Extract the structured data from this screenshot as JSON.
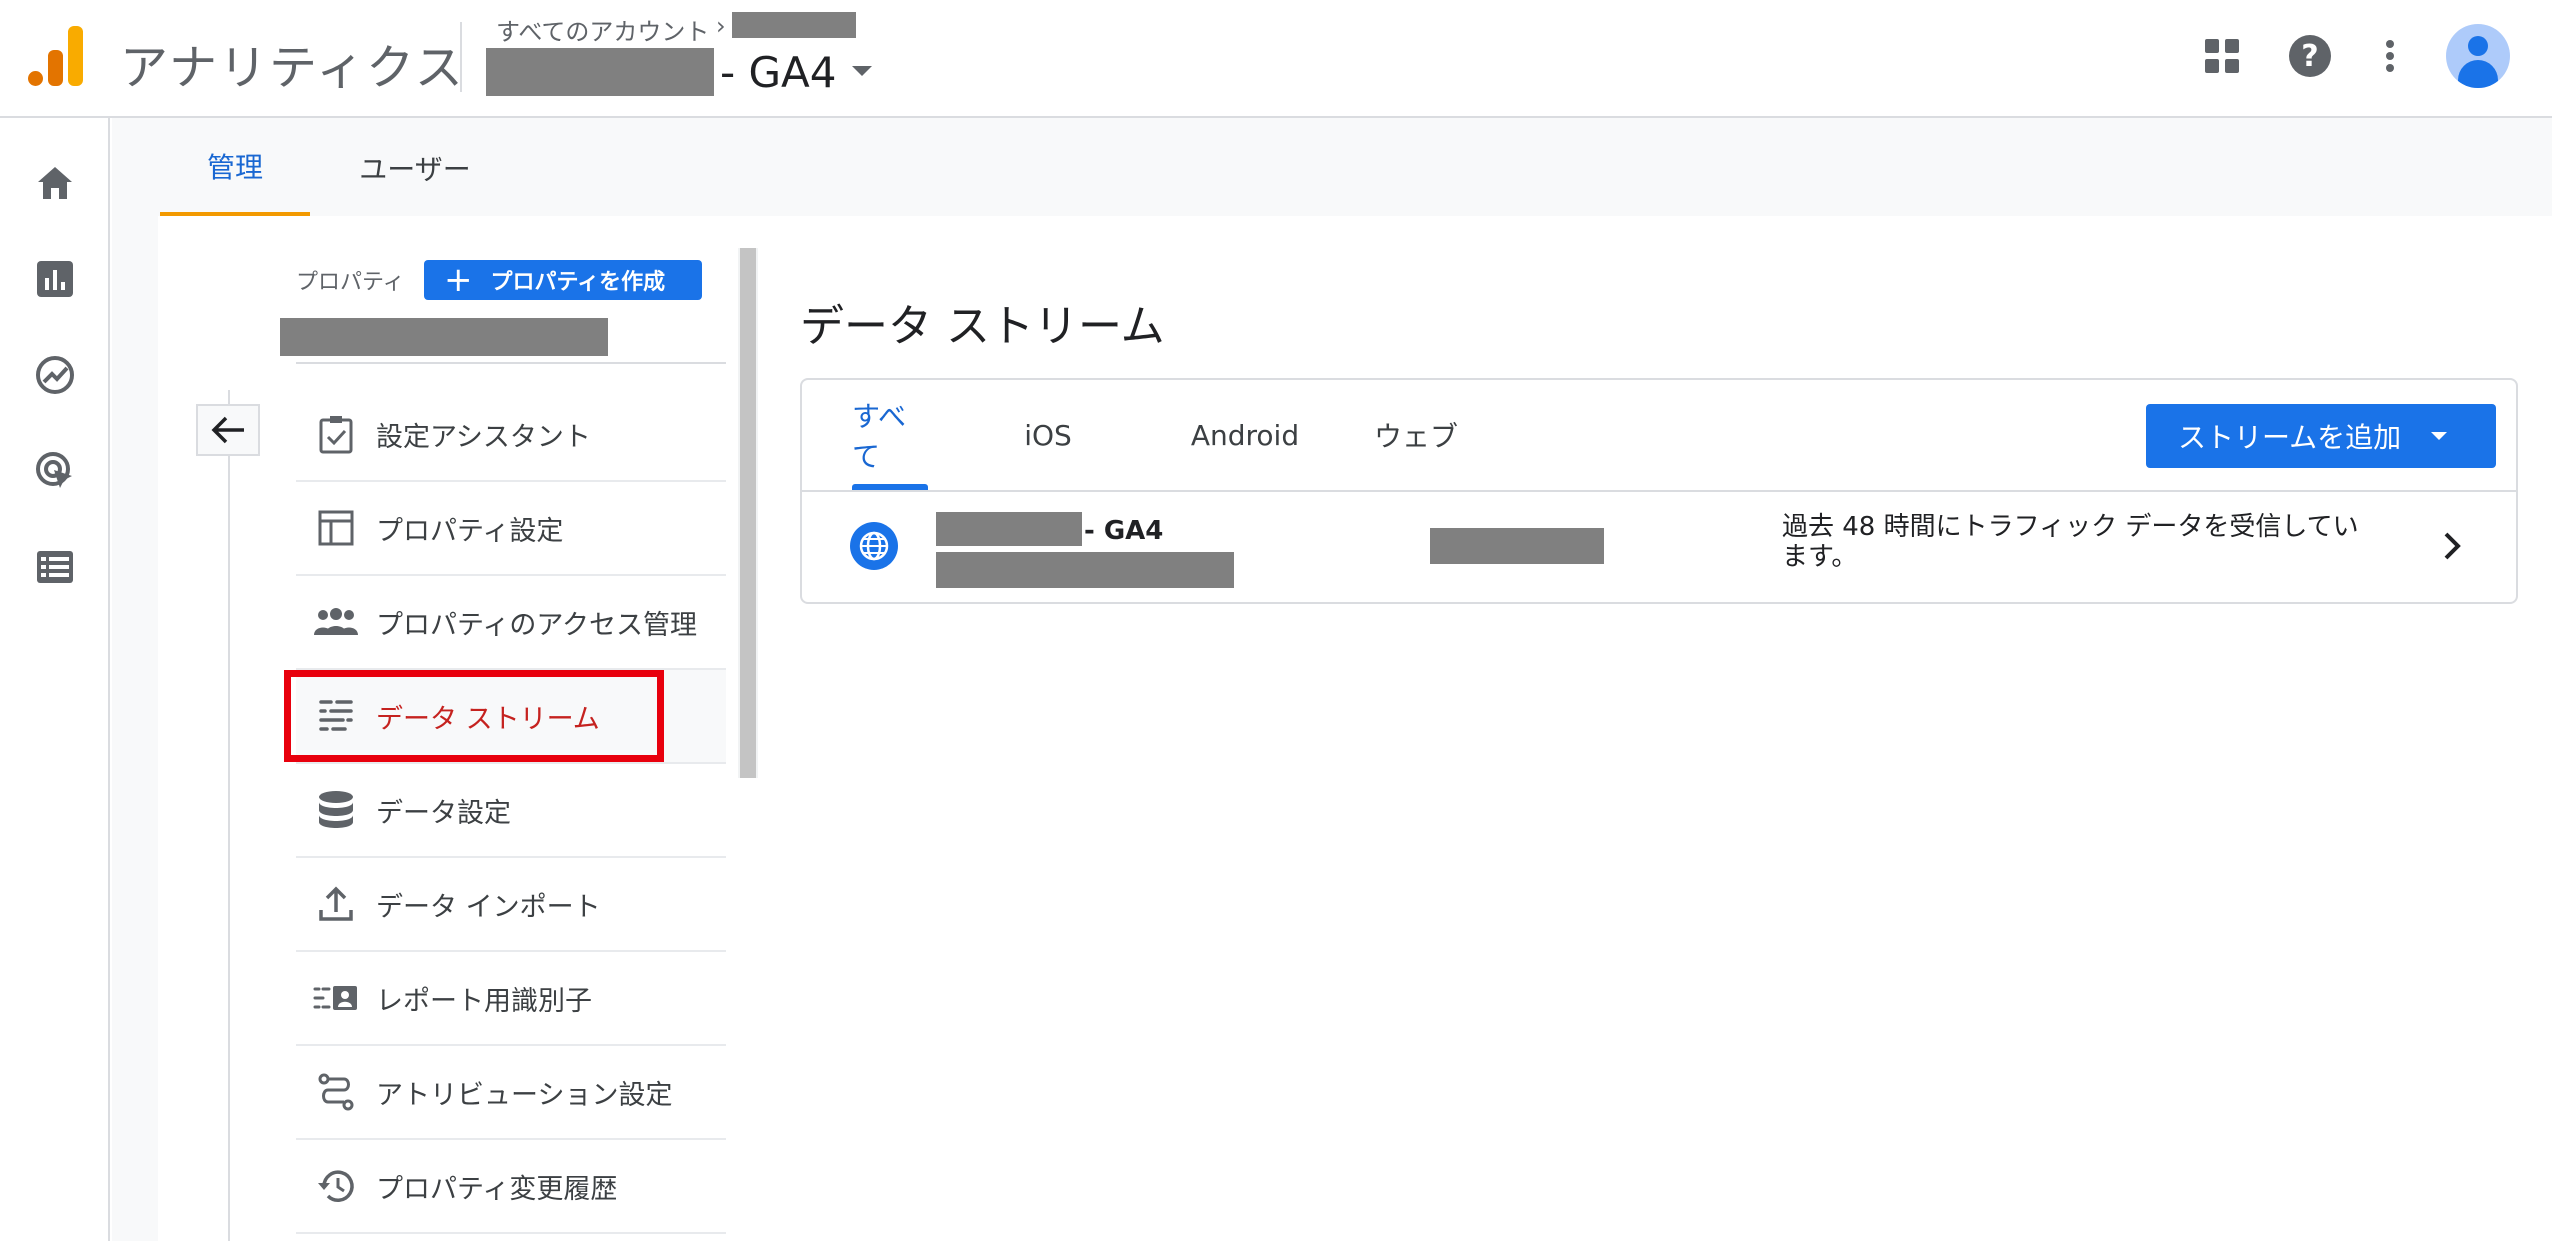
{
  "header": {
    "app_title": "アナリティクス",
    "breadcrumb": "すべてのアカウント",
    "property_suffix": "- GA4"
  },
  "tabs": [
    {
      "label": "管理",
      "active": true
    },
    {
      "label": "ユーザー",
      "active": false
    }
  ],
  "property_panel": {
    "label": "プロパティ",
    "create_button": "プロパティを作成"
  },
  "menu": [
    {
      "label": "設定アシスタント",
      "icon": "clipboard-check-icon"
    },
    {
      "label": "プロパティ設定",
      "icon": "layout-icon"
    },
    {
      "label": "プロパティのアクセス管理",
      "icon": "people-icon"
    },
    {
      "label": "データ ストリーム",
      "icon": "streams-icon",
      "active": true
    },
    {
      "label": "データ設定",
      "icon": "database-icon"
    },
    {
      "label": "データ インポート",
      "icon": "upload-icon"
    },
    {
      "label": "レポート用識別子",
      "icon": "id-icon"
    },
    {
      "label": "アトリビューション設定",
      "icon": "attribution-icon"
    },
    {
      "label": "プロパティ変更履歴",
      "icon": "history-icon"
    }
  ],
  "main": {
    "title": "データ ストリーム",
    "stream_tabs": [
      "すべて",
      "iOS",
      "Android",
      "ウェブ"
    ],
    "add_button": "ストリームを追加",
    "stream": {
      "name_suffix": "- GA4",
      "status": "過去 48 時間にトラフィック データを受信しています。"
    }
  },
  "colors": {
    "accent": "#1a73e8",
    "active_tab": "#1967d2",
    "tab_underline": "#f29900",
    "highlight": "#e8000d"
  }
}
